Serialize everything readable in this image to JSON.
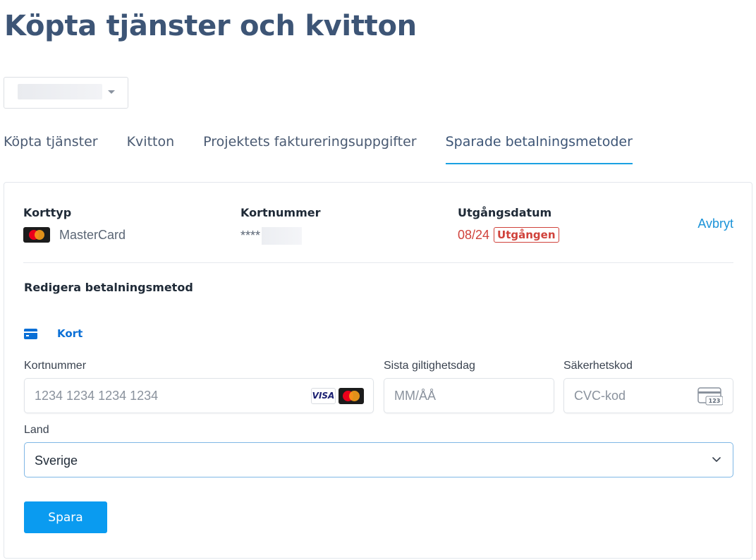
{
  "page": {
    "title": "Köpta tjänster och kvitton"
  },
  "project_select": {
    "value": ""
  },
  "tabs": [
    {
      "label": "Köpta tjänster",
      "active": false
    },
    {
      "label": "Kvitton",
      "active": false
    },
    {
      "label": "Projektets faktureringsuppgifter",
      "active": false
    },
    {
      "label": "Sparade betalningsmetoder",
      "active": true
    }
  ],
  "saved_card": {
    "type_label": "Korttyp",
    "type_value": "MasterCard",
    "number_label": "Kortnummer",
    "number_masked": "****",
    "expiry_label": "Utgångsdatum",
    "expiry_value": "08/24",
    "expiry_status": "Utgången",
    "cancel_label": "Avbryt"
  },
  "edit_form": {
    "title": "Redigera betalningsmetod",
    "method_label": "Kort",
    "card_number_label": "Kortnummer",
    "card_number_placeholder": "1234 1234 1234 1234",
    "card_brands": [
      "VISA",
      "MasterCard"
    ],
    "expiry_label": "Sista giltighetsdag",
    "expiry_placeholder": "MM/ÅÅ",
    "cvc_label": "Säkerhetskod",
    "cvc_placeholder": "CVC-kod",
    "cvc_icon_text": "123",
    "country_label": "Land",
    "country_value": "Sverige",
    "save_label": "Spara"
  },
  "colors": {
    "accent": "#1ba1e2",
    "primary_button": "#0a9bf0",
    "expired": "#d0423b",
    "title": "#3d5576",
    "link": "#1b93d8"
  }
}
